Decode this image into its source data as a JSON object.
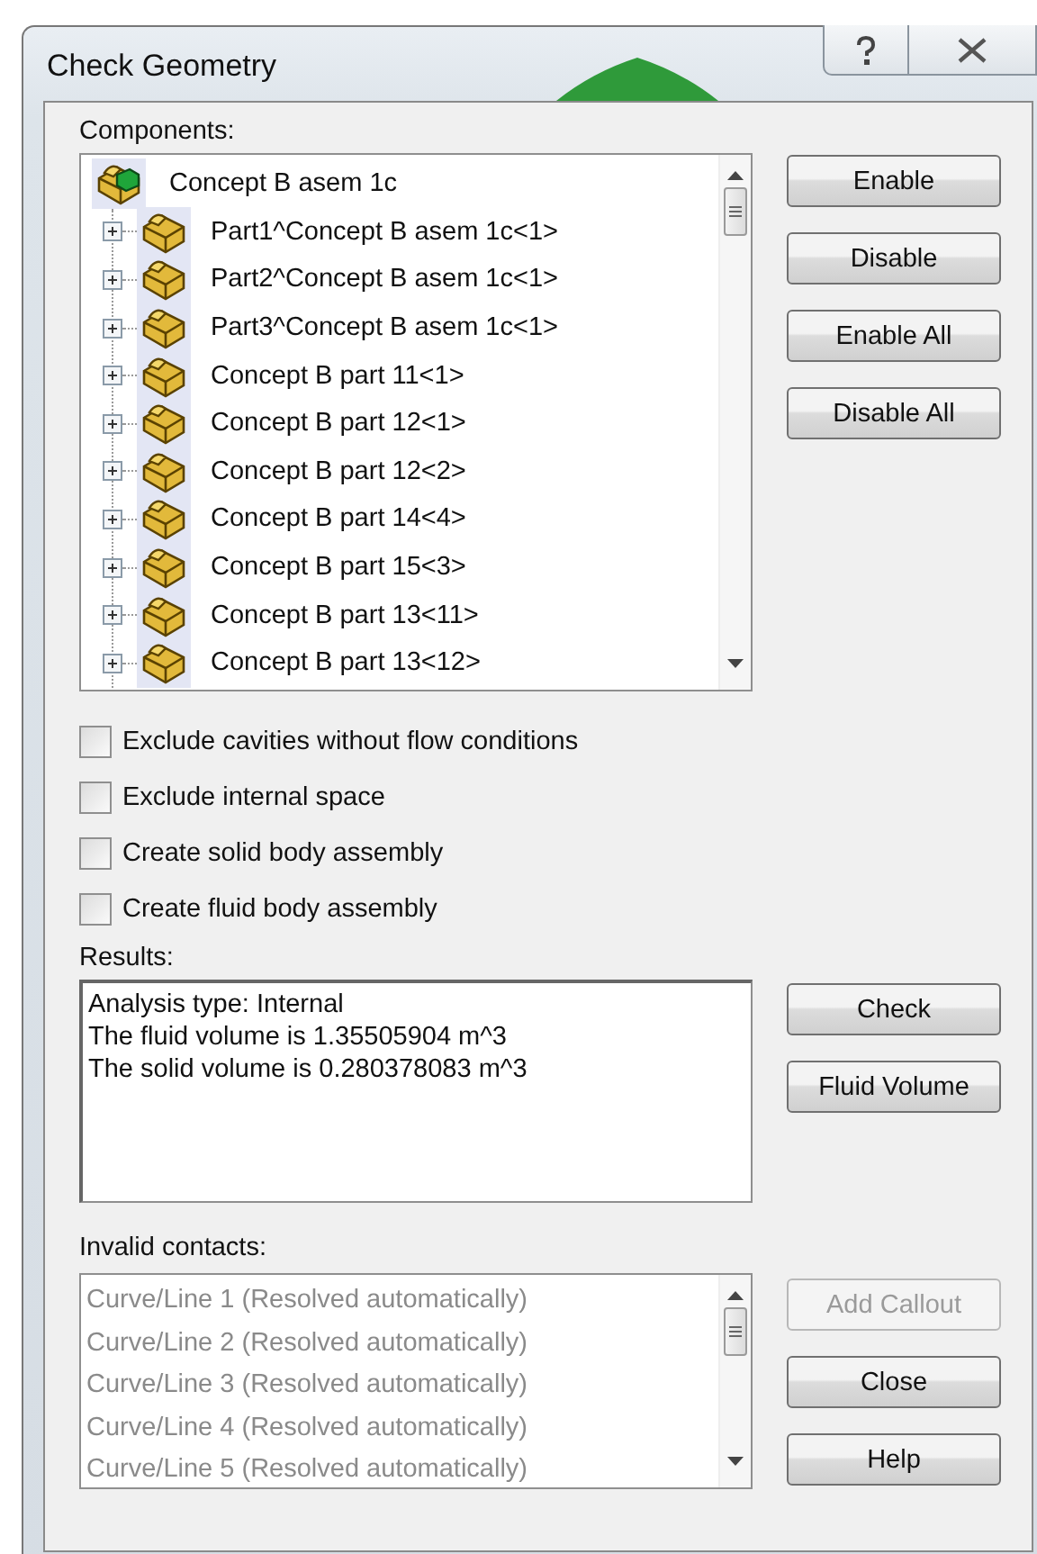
{
  "window": {
    "title": "Check Geometry"
  },
  "components": {
    "label": "Components:",
    "tree": {
      "name": "Concept B asem 1c",
      "children": [
        {
          "name": "Part1^Concept B asem 1c<1>",
          "expanded": false
        },
        {
          "name": "Part2^Concept B asem 1c<1>",
          "expanded": false
        },
        {
          "name": "Part3^Concept B asem 1c<1>",
          "expanded": false
        },
        {
          "name": "Concept B part 11<1>",
          "expanded": false
        },
        {
          "name": "Concept B part 12<1>",
          "expanded": false
        },
        {
          "name": "Concept B part 12<2>",
          "expanded": false
        },
        {
          "name": "Concept B part 14<4>",
          "expanded": false
        },
        {
          "name": "Concept B part 15<3>",
          "expanded": false
        },
        {
          "name": "Concept B part 13<11>",
          "expanded": false
        },
        {
          "name": "Concept B part 13<12>",
          "expanded": false
        }
      ]
    }
  },
  "component_buttons": [
    {
      "label": "Enable",
      "disabled": false
    },
    {
      "label": "Disable",
      "disabled": false
    },
    {
      "label": "Enable All",
      "disabled": false
    },
    {
      "label": "Disable All",
      "disabled": false
    }
  ],
  "options": [
    {
      "label": "Exclude cavities without flow conditions",
      "checked": false
    },
    {
      "label": "Exclude internal space",
      "checked": false
    },
    {
      "label": "Create solid body assembly",
      "checked": false
    },
    {
      "label": "Create fluid body assembly",
      "checked": false
    }
  ],
  "results": {
    "label": "Results:",
    "lines": [
      "Analysis type: Internal",
      "The fluid volume is 1.35505904 m^3",
      "The solid volume is 0.280378083 m^3"
    ]
  },
  "result_buttons": [
    {
      "label": "Check",
      "disabled": false
    },
    {
      "label": "Fluid Volume",
      "disabled": false
    }
  ],
  "invalid_contacts": {
    "label": "Invalid contacts:",
    "items": [
      "Curve/Line 1 (Resolved automatically)",
      "Curve/Line 2 (Resolved automatically)",
      "Curve/Line 3 (Resolved automatically)",
      "Curve/Line 4 (Resolved automatically)",
      "Curve/Line 5 (Resolved automatically)"
    ]
  },
  "contact_buttons": [
    {
      "label": "Add Callout",
      "disabled": true
    },
    {
      "label": "Close",
      "disabled": false
    },
    {
      "label": "Help",
      "disabled": false
    }
  ]
}
